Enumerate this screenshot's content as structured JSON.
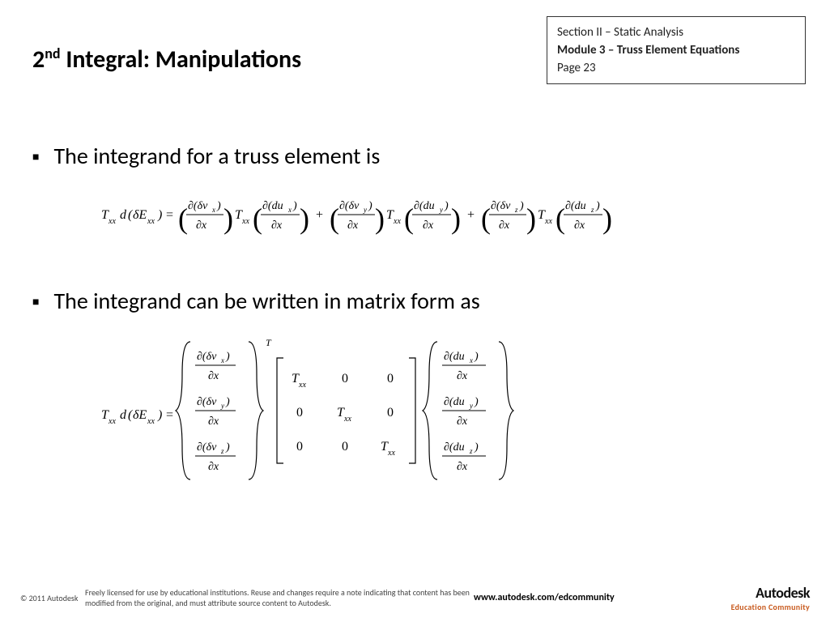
{
  "header": {
    "section": "Section II – Static Analysis",
    "module": "Module 3 – Truss Element Equations",
    "page": "Page 23"
  },
  "title_pre": "2",
  "title_sup": "nd",
  "title_rest": " Integral: Manipulations",
  "bullets": {
    "b1": "The integrand for a truss element is",
    "b2": "The integrand can be written in matrix form as"
  },
  "equations": {
    "eq1_lhs": "T_{xx} d(\\delta E_{xx}) =",
    "eq1_rhs": "(\\partial(\\delta v_x)/\\partial x) T_{xx} (\\partial(du_x)/\\partial x) + (\\partial(\\delta v_y)/\\partial x) T_{xx} (\\partial(du_y)/\\partial x) + (\\partial(\\delta v_z)/\\partial x) T_{xx} (\\partial(du_z)/\\partial x)",
    "eq2_lhs": "T_{xx} d(\\delta E_{xx}) =",
    "eq2_vector_left": [
      "\\partial(\\delta v_x)/\\partial x",
      "\\partial(\\delta v_y)/\\partial x",
      "\\partial(\\delta v_z)/\\partial x"
    ],
    "eq2_vector_left_trans": "T",
    "eq2_matrix": [
      [
        "T_{xx}",
        "0",
        "0"
      ],
      [
        "0",
        "T_{xx}",
        "0"
      ],
      [
        "0",
        "0",
        "T_{xx}"
      ]
    ],
    "eq2_vector_right": [
      "\\partial(du_x)/\\partial x",
      "\\partial(du_y)/\\partial x",
      "\\partial(du_z)/\\partial x"
    ]
  },
  "footer": {
    "copy": "© 2011 Autodesk",
    "license": "Freely licensed for use by educational institutions. Reuse and changes require a note indicating that content has been modified from the original, and must attribute source content to Autodesk.",
    "site": "www.autodesk.com/edcommunity",
    "brand_main": "Autodesk",
    "brand_sub": "Education Community"
  }
}
